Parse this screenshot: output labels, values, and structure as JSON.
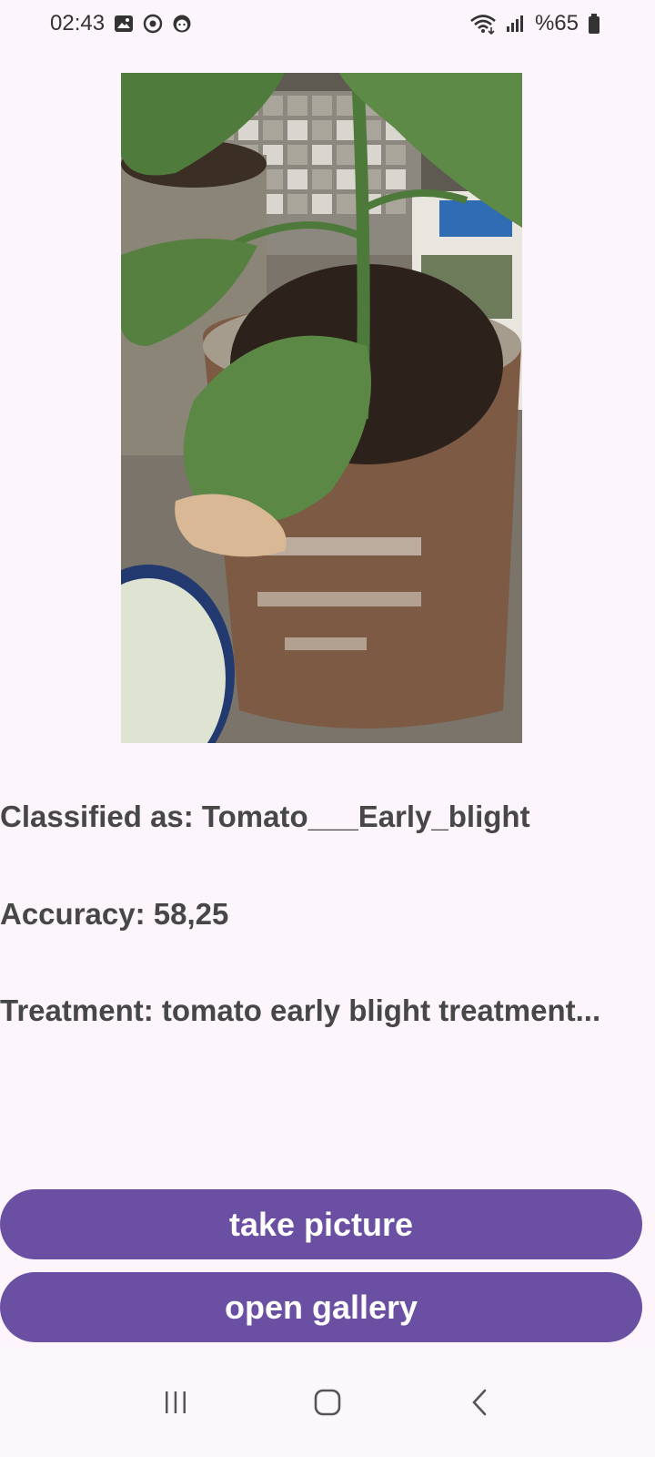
{
  "status_bar": {
    "time": "02:43",
    "battery_text": "%65",
    "left_icons": [
      "gallery-notification-icon",
      "sync-notification-icon",
      "face-notification-icon"
    ],
    "right_icons": [
      "wifi-icon",
      "signal-icon",
      "battery-icon"
    ]
  },
  "image": {
    "subject": "plant-photo"
  },
  "results": {
    "classified": "Classified as: Tomato___Early_blight",
    "accuracy": "Accuracy: 58,25",
    "treatment": "Treatment: tomato early blight treatment..."
  },
  "buttons": {
    "take_picture": "take picture",
    "open_gallery": "open gallery"
  },
  "nav": {
    "icons": [
      "recent-apps-icon",
      "home-icon",
      "back-icon"
    ]
  },
  "colors": {
    "background": "#FCF5FC",
    "button": "#6A4FA3",
    "button_text": "#FFFFFF",
    "text": "#474747"
  }
}
